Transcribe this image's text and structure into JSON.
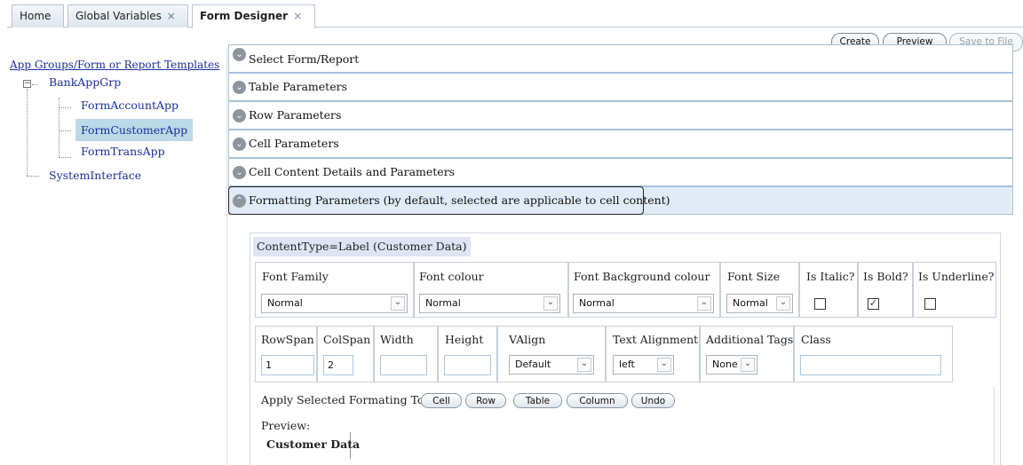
{
  "tabs": [
    {
      "label": "Home",
      "closable": false
    },
    {
      "label": "Global Variables",
      "closable": true
    },
    {
      "label": "Form Designer",
      "closable": true,
      "active": true
    }
  ],
  "tab_close_glyph": "×",
  "toolbar": {
    "create": "Create",
    "preview": "Preview",
    "save_to_file": "Save to File"
  },
  "tree": {
    "title": "App Groups/Form or Report Templates",
    "expander_glyph": "−",
    "nodes": [
      {
        "label": "BankAppGrp"
      },
      {
        "label": "FormAccountApp"
      },
      {
        "label": "FormCustomerApp",
        "selected": true
      },
      {
        "label": "FormTransApp"
      },
      {
        "label": "SystemInterface"
      }
    ]
  },
  "accordion": [
    {
      "label": "Select Form/Report",
      "icon": "chevron-down-icon"
    },
    {
      "label": "Table Parameters",
      "icon": "chevron-down-icon"
    },
    {
      "label": "Row Parameters",
      "icon": "chevron-down-icon"
    },
    {
      "label": "Cell Parameters",
      "icon": "chevron-down-icon"
    },
    {
      "label": "Cell Content Details and Parameters",
      "icon": "chevron-down-icon"
    },
    {
      "label": "Formatting Parameters (by default, selected are applicable to cell content)",
      "icon": "chevron-up-icon",
      "expanded": true
    }
  ],
  "chevron_down_glyph": "⌄",
  "chevron_up_glyph": "⌃",
  "select_arrow_glyph": "⌄",
  "formatting": {
    "content_type": "ContentType=Label (Customer Data)",
    "font_family": {
      "label": "Font Family",
      "value": "Normal"
    },
    "font_colour": {
      "label": "Font colour",
      "value": "Normal"
    },
    "font_bg_colour": {
      "label": "Font Background colour",
      "value": "Normal"
    },
    "font_size": {
      "label": "Font Size",
      "value": "Normal"
    },
    "is_italic": {
      "label": "Is Italic?",
      "checked": false
    },
    "is_bold": {
      "label": "Is Bold?",
      "checked": true
    },
    "is_underline": {
      "label": "Is Underline?",
      "checked": false
    },
    "check_glyph": "✓",
    "rowspan": {
      "label": "RowSpan",
      "value": "1"
    },
    "colspan": {
      "label": "ColSpan",
      "value": "2"
    },
    "width": {
      "label": "Width",
      "value": ""
    },
    "height": {
      "label": "Height",
      "value": ""
    },
    "valign": {
      "label": "VAlign",
      "value": "Default"
    },
    "text_alignment": {
      "label": "Text Alignment",
      "value": "left"
    },
    "additional_tags": {
      "label": "Additional Tags",
      "value": "None"
    },
    "class": {
      "label": "Class",
      "value": ""
    },
    "apply_label": "Apply Selected Formating To:",
    "apply_buttons": {
      "cell": "Cell",
      "row": "Row",
      "table": "Table",
      "column": "Column",
      "undo": "Undo"
    },
    "preview_label": "Preview:",
    "preview_text": "Customer Data"
  },
  "colors": {
    "accent_border": "#a9c0dd",
    "selected_bg": "#bcd9e8",
    "open_row_bg": "#e1ebf7",
    "link": "#1a2fa0"
  }
}
